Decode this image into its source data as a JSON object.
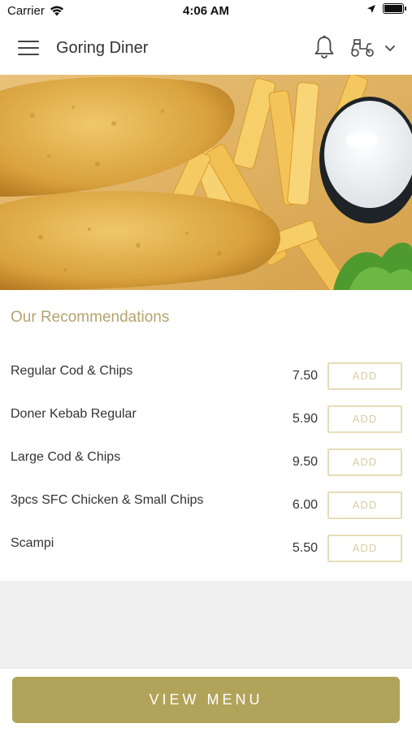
{
  "status_bar": {
    "carrier": "Carrier",
    "time": "4:06 AM"
  },
  "header": {
    "title": "Goring Diner",
    "icons": [
      "menu-icon",
      "bell-icon",
      "delivery-scooter-icon",
      "chevron-down-icon"
    ]
  },
  "hero": {
    "image": "fish-and-chips-photo"
  },
  "recommendations": {
    "title": "Our Recommendations",
    "add_label": "ADD",
    "items": [
      {
        "name": "Regular Cod & Chips",
        "price": "7.50"
      },
      {
        "name": "Doner Kebab Regular",
        "price": "5.90"
      },
      {
        "name": "Large Cod & Chips",
        "price": "9.50"
      },
      {
        "name": "3pcs SFC Chicken & Small Chips",
        "price": "6.00"
      },
      {
        "name": "Scampi",
        "price": "5.50"
      }
    ]
  },
  "footer": {
    "view_menu_label": "VIEW MENU"
  },
  "colors": {
    "accent": "#b2a35a",
    "title_text": "#b3a46d",
    "add_border": "#e6dcb7"
  }
}
